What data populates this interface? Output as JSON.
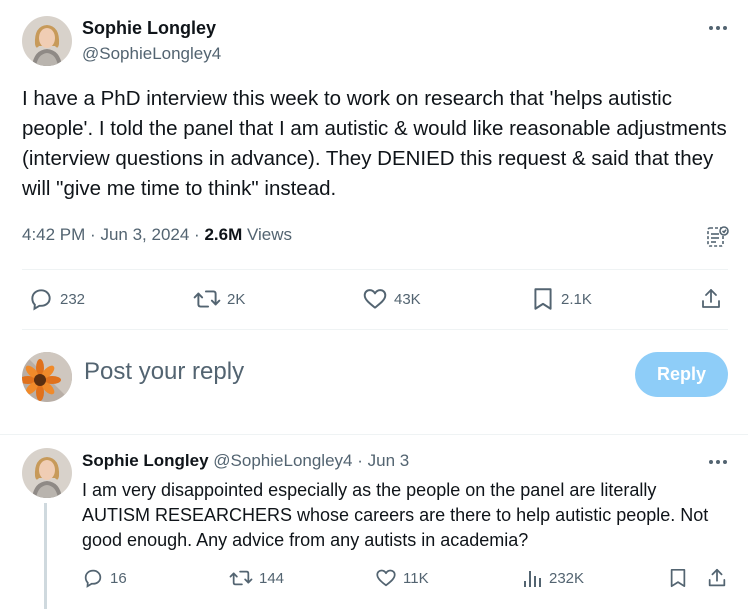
{
  "main_tweet": {
    "author_name": "Sophie Longley",
    "author_handle": "@SophieLongley4",
    "text": "I have a PhD interview this week to work on research that 'helps autistic people'. I told the panel that I am autistic & would like reasonable adjustments (interview questions in advance). They DENIED this request & said that they will \"give me time to think\" instead.",
    "time": "4:42 PM",
    "date": "Jun 3, 2024",
    "separator": "·",
    "views_count": "2.6M",
    "views_label": "Views",
    "actions": {
      "replies": "232",
      "reposts": "2K",
      "likes": "43K",
      "bookmarks": "2.1K"
    }
  },
  "reply_box": {
    "placeholder": "Post your reply",
    "button_label": "Reply"
  },
  "reply_tweet": {
    "author_name": "Sophie Longley",
    "author_handle": "@SophieLongley4",
    "date": "Jun 3",
    "separator": "·",
    "text": "I am very disappointed especially as the people on the panel are literally AUTISM RESEARCHERS whose careers are there to help autistic people. Not good enough. Any advice from any autists in academia?",
    "actions": {
      "replies": "16",
      "reposts": "144",
      "likes": "11K",
      "views": "232K"
    }
  },
  "colors": {
    "text_primary": "#0f1419",
    "text_secondary": "#536471",
    "reply_button_bg": "#8ecdf8",
    "divider": "#eff3f4"
  },
  "icons": [
    "more-icon",
    "grok-analytics-icon",
    "reply-icon",
    "repost-icon",
    "like-icon",
    "bookmark-icon",
    "share-icon",
    "views-icon"
  ]
}
